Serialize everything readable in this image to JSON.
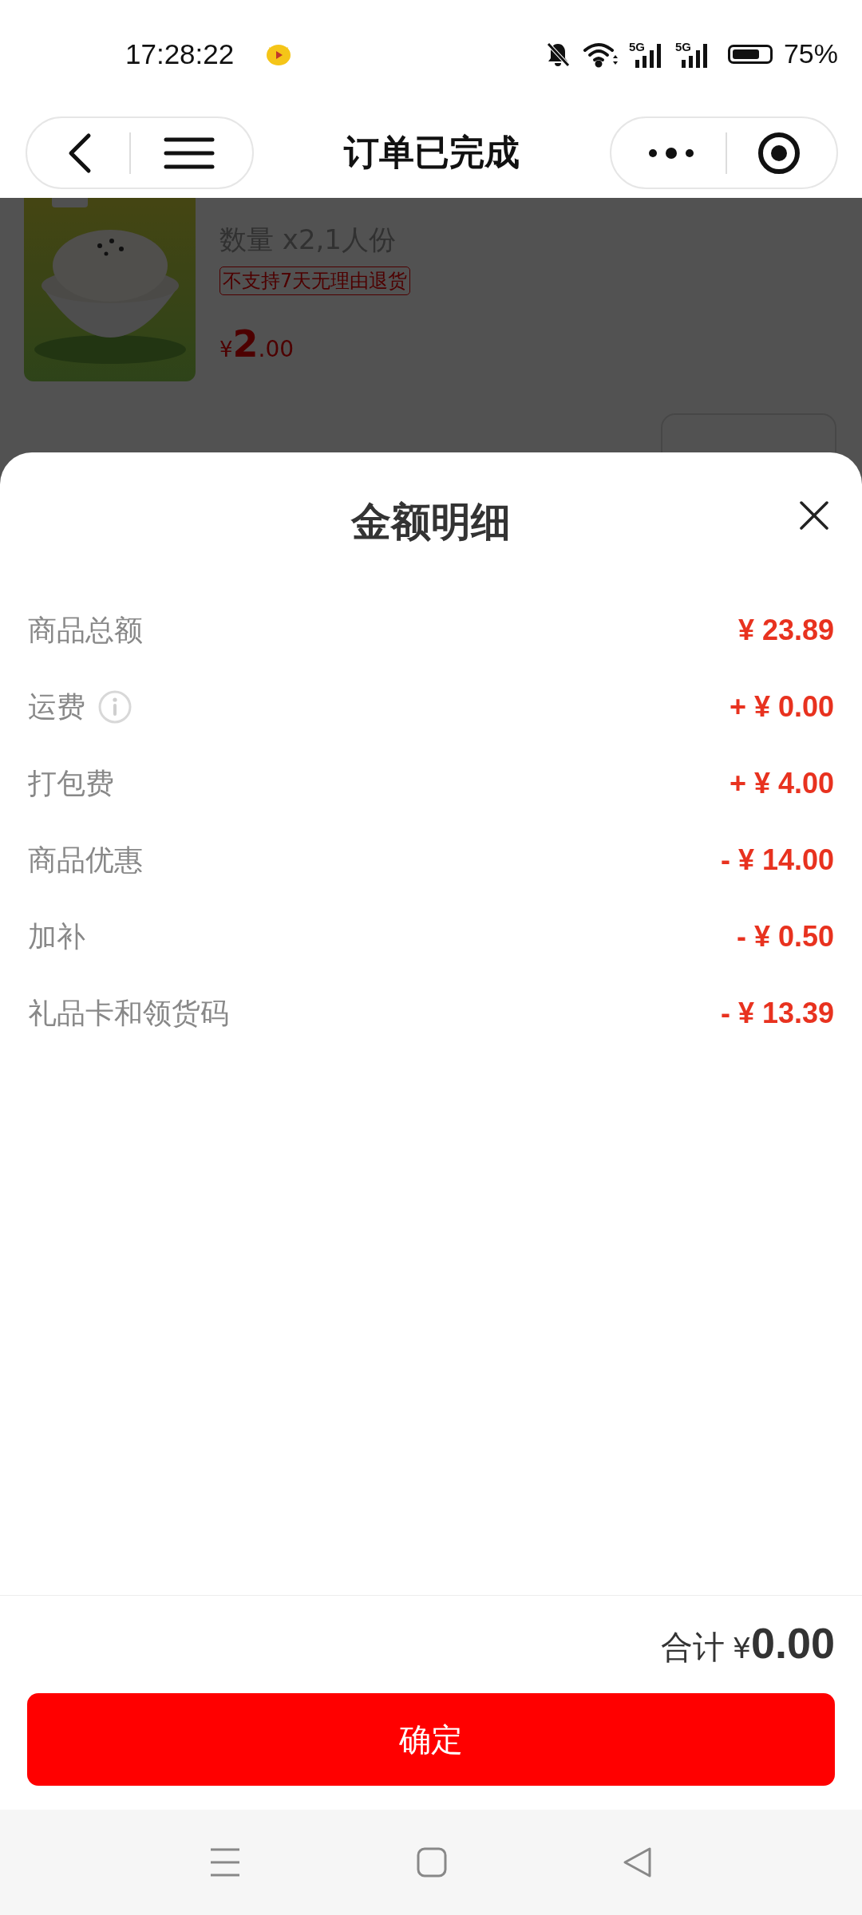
{
  "status_bar": {
    "time": "17:28:22",
    "networks": [
      "5G",
      "5G"
    ],
    "battery": "75%"
  },
  "nav": {
    "title": "订单已完成"
  },
  "order_item": {
    "quantity": "数量 x2,1人份",
    "tag": "不支持7天无理由退货",
    "price_symbol": "¥",
    "price_integer": "2",
    "price_decimal": ".00"
  },
  "sheet": {
    "title": "金额明细",
    "rows": [
      {
        "label": "商品总额",
        "value": "¥ 23.89",
        "info": false
      },
      {
        "label": "运费",
        "value": "+ ¥ 0.00",
        "info": true
      },
      {
        "label": "打包费",
        "value": "+ ¥ 4.00",
        "info": false
      },
      {
        "label": "商品优惠",
        "value": "- ¥ 14.00",
        "info": false
      },
      {
        "label": "加补",
        "value": "- ¥ 0.50",
        "info": false
      },
      {
        "label": "礼品卡和领货码",
        "value": "- ¥ 13.39",
        "info": false
      }
    ],
    "total": {
      "label": "合计",
      "currency": "¥",
      "amount": "0.00"
    },
    "confirm_button": "确定"
  }
}
